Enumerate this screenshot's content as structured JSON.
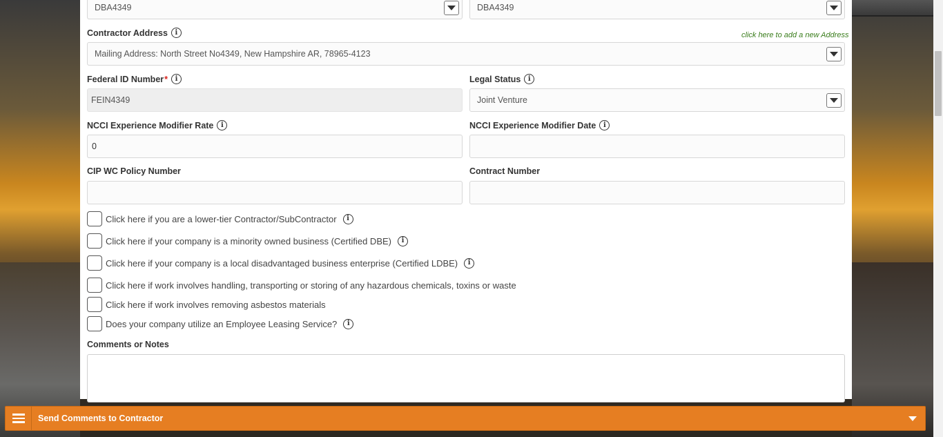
{
  "form": {
    "dba_left": "DBA4349",
    "dba_right": "DBA4349",
    "contractor_address": {
      "label": "Contractor Address",
      "add_link": "click here to add a new Address",
      "value": "Mailing Address: North Street No4349, New Hampshire AR, 78965-4123"
    },
    "federal_id": {
      "label": "Federal ID Number",
      "required": "*",
      "value": "FEIN4349"
    },
    "legal_status": {
      "label": "Legal Status",
      "value": "Joint Venture"
    },
    "ncci_rate": {
      "label": "NCCI Experience Modifier Rate",
      "value": "0"
    },
    "ncci_date": {
      "label": "NCCI Experience Modifier Date",
      "value": ""
    },
    "cip_policy": {
      "label": "CIP WC Policy Number",
      "value": ""
    },
    "contract_number": {
      "label": "Contract Number",
      "value": ""
    },
    "checkboxes": [
      {
        "label": "Click here if you are a lower-tier Contractor/SubContractor",
        "info": true
      },
      {
        "label": "Click here if your company is a minority owned business (Certified DBE)",
        "info": true
      },
      {
        "label": "Click here if your company is a local disadvantaged business enterprise (Certified LDBE)",
        "info": true
      },
      {
        "label": "Click here if work involves handling, transporting or storing of any hazardous chemicals, toxins or waste",
        "info": false
      },
      {
        "label": "Click here if work involves removing asbestos materials",
        "info": false
      },
      {
        "label": "Does your company utilize an Employee Leasing Service?",
        "info": true
      }
    ],
    "comments": {
      "label": "Comments or Notes",
      "value": ""
    }
  },
  "footer": {
    "title": "Send Comments to Contractor"
  },
  "icons": {
    "info": "info-icon",
    "dropdown": "chevron-down-icon",
    "menu": "hamburger-menu-icon"
  },
  "colors": {
    "accent": "#e67e22",
    "link": "#3a7d1c",
    "required": "#d9231d"
  }
}
